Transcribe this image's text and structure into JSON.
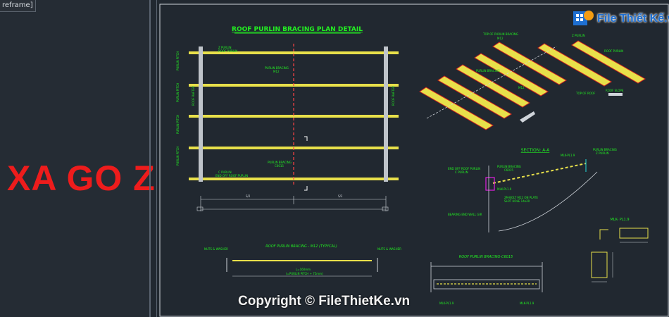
{
  "viewport_label": "reframe]",
  "overlay_title": "XA GO Z",
  "watermark": "Copyright © FileThietKe.vn",
  "logo": {
    "text": "File Thiết Kế.vn",
    "icon": "grid-globe-icon"
  },
  "colors": {
    "background": "#212830",
    "title_red": "#ee1c1c",
    "cad_green": "#22ee22",
    "purlin_yellow": "#e8e04a",
    "beam_red": "#d22020",
    "dim_white": "#cfd4da",
    "cyan": "#22dddd",
    "magenta": "#e020e0"
  },
  "drawing": {
    "plan_title": "ROOF PURLIN BRACING PLAN DETAIL",
    "section_title": "SECTION: A-A",
    "bracing_m12_title": "ROOF PURLIN BRACING - M12 (TYPYCAL)",
    "bracing_c6015_title": "ROOF PURLIN BRACING-C6015",
    "plate_title": "MLK- PL1.9",
    "plan_labels": [
      "Z PURLIN",
      "ROOF PURLIN",
      "PURLIN BRACING",
      "M12",
      "C PURLIN",
      "END OFF ROOF PURLIN",
      "PURLIN BRACING",
      "C6015"
    ],
    "iso_labels": [
      "TOP OF PURLIN BRACING",
      "M12",
      "Z PURLIN",
      "ROOF PURLIN",
      "PURLIN BRACING",
      "M12",
      "TOP OF ROOF",
      "ROOF SLOPE"
    ],
    "dimensions": [
      "S/2",
      "S/2",
      "L=160mm",
      "(=PURLIN PITCH + 75mm)"
    ],
    "section_labels": [
      "END OFF ROOF PURLIN",
      "C PURLIN",
      "PURLIN BRACING",
      "C6015",
      "MLK-PL1.9",
      "PURLIN BRACING",
      "Z PURLIN",
      "2M-BOLT M12 ON PLATE",
      "SLOT HOLE 14x20",
      "BEARING END WALL GIR",
      "MLK-PL1.9"
    ],
    "bracing_labels": [
      "NUTS & WASHER",
      "NUTS & WASHER",
      "MLK-PL1.9",
      "MLK-PL1.9"
    ]
  }
}
